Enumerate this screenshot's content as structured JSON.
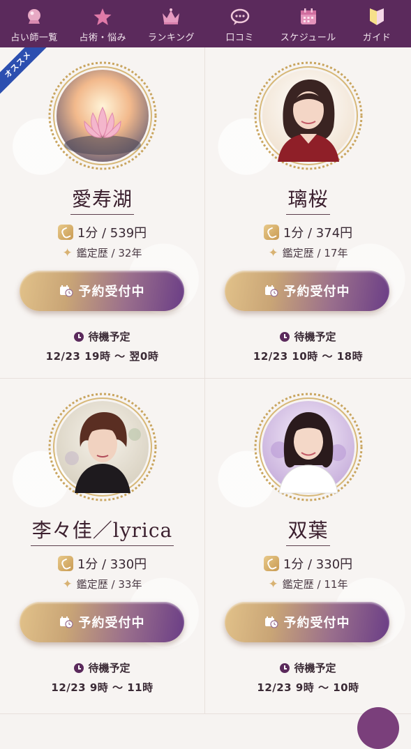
{
  "nav": {
    "items": [
      {
        "label": "占い師一覧",
        "icon": "crystal-ball-icon"
      },
      {
        "label": "占術・悩み",
        "icon": "star-icon"
      },
      {
        "label": "ランキング",
        "icon": "crown-icon"
      },
      {
        "label": "口コミ",
        "icon": "chat-bubble-icon"
      },
      {
        "label": "スケジュール",
        "icon": "calendar-icon"
      },
      {
        "label": "ガイド",
        "icon": "beginner-mark-icon"
      }
    ]
  },
  "ribbon": {
    "label": "オススメ"
  },
  "cards": [
    {
      "name": "愛寿湖",
      "price": "1分 / 539円",
      "career": "鑑定歴 / 32年",
      "button": "予約受付中",
      "standby": "待機予定",
      "schedule": "12/23 19時 〜 翌0時"
    },
    {
      "name": "璃桜",
      "price": "1分 / 374円",
      "career": "鑑定歴 / 17年",
      "button": "予約受付中",
      "standby": "待機予定",
      "schedule": "12/23 10時 〜 18時"
    },
    {
      "name": "李々佳／lyrica",
      "price": "1分 / 330円",
      "career": "鑑定歴 / 33年",
      "button": "予約受付中",
      "standby": "待機予定",
      "schedule": "12/23 9時 〜 11時"
    },
    {
      "name": "双葉",
      "price": "1分 / 330円",
      "career": "鑑定歴 / 11年",
      "button": "予約受付中",
      "standby": "待機予定",
      "schedule": "12/23 9時 〜 10時"
    }
  ],
  "colors": {
    "nav_bg": "#5b2a5c",
    "accent_gold": "#c9a576",
    "accent_purple": "#6a3d86",
    "ribbon": "#2c4fb0"
  }
}
